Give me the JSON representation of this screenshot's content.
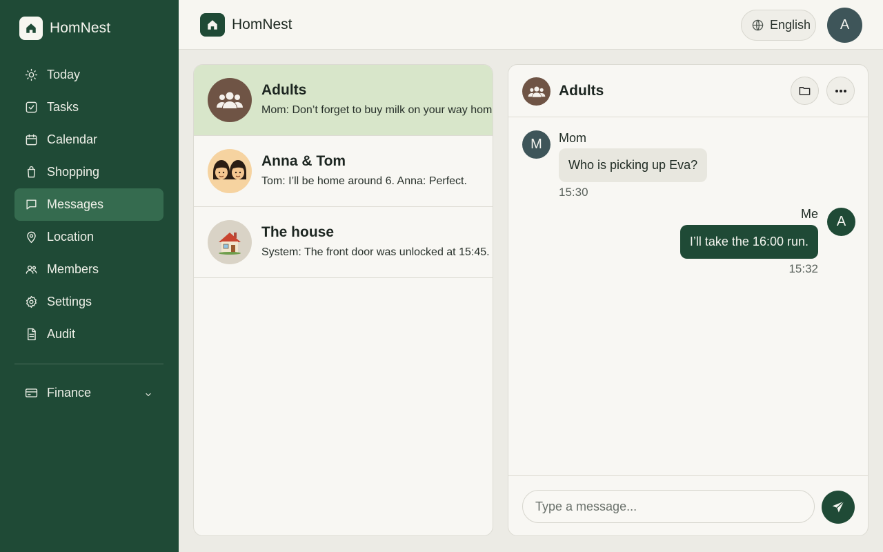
{
  "app": {
    "name": "HomNest"
  },
  "sidebar": {
    "items": [
      {
        "label": "Today",
        "icon": "sun-icon"
      },
      {
        "label": "Tasks",
        "icon": "checkbox-icon"
      },
      {
        "label": "Calendar",
        "icon": "calendar-icon"
      },
      {
        "label": "Shopping",
        "icon": "shopping-bag-icon"
      },
      {
        "label": "Messages",
        "icon": "chat-icon",
        "active": true
      },
      {
        "label": "Location",
        "icon": "map-pin-icon"
      },
      {
        "label": "Members",
        "icon": "users-icon"
      },
      {
        "label": "Settings",
        "icon": "gear-icon"
      },
      {
        "label": "Audit",
        "icon": "document-icon"
      }
    ],
    "finance": {
      "label": "Finance",
      "icon": "credit-card-icon"
    }
  },
  "header": {
    "title": "HomNest",
    "language": "English",
    "avatar_initial": "A"
  },
  "conversations": [
    {
      "name": "Adults",
      "preview": "Mom: Don’t forget to buy milk on your way home.",
      "avatar": "group-icon",
      "active": true
    },
    {
      "name": "Anna & Tom",
      "preview": "Tom: I’ll be home around 6. Anna: Perfect.",
      "avatar": "two-kids-emoji"
    },
    {
      "name": "The house",
      "preview": "System: The front door was unlocked at 15:45.",
      "avatar": "house-emoji"
    }
  ],
  "chat": {
    "title": "Adults",
    "messages": [
      {
        "sender": "Mom",
        "initial": "M",
        "text": "Who is picking up Eva?",
        "time": "15:30",
        "direction": "in"
      },
      {
        "sender": "Me",
        "initial": "A",
        "text": "I’ll take the 16:00 run.",
        "time": "15:32",
        "direction": "out"
      }
    ],
    "composer_placeholder": "Type a message..."
  },
  "colors": {
    "sidebar_bg": "#1f4a36",
    "accent": "#1f4a36",
    "active_conversation": "#d8e6ca",
    "active_nav": "#356b4f"
  }
}
